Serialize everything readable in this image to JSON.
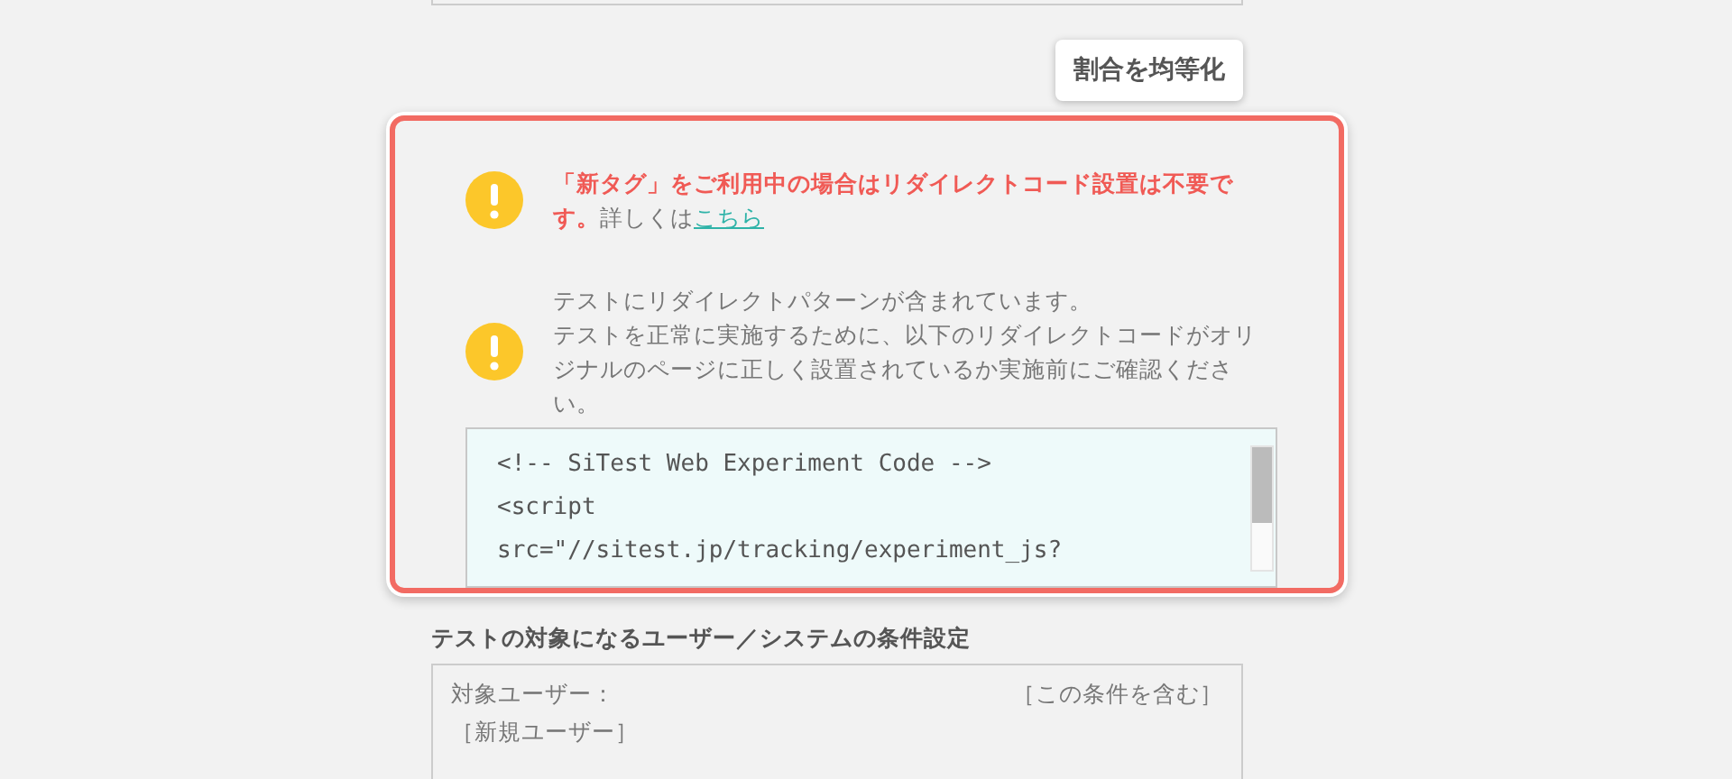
{
  "equalize_button": {
    "label": "割合を均等化"
  },
  "notice_dialog": {
    "warnings": [
      {
        "kind": "tag",
        "emphasis": "「新タグ」をご利用中の場合はリダイレクトコード設置は不要です。",
        "text": "詳しくは",
        "link": "こちら"
      },
      {
        "kind": "redirect",
        "lines": [
          "テストにリダイレクトパターンが含まれています。",
          "テストを正常に実施するために、以下のリダイレクトコードがオリジナルのページに正しく設置されているか実施前にご確認ください。"
        ]
      }
    ],
    "code_lines": [
      "<!-- SiTest Web Experiment Code -->",
      "<script",
      "src=\"//sitest.jp/tracking/experiment_js?"
    ]
  },
  "conditions": {
    "heading": "テストの対象になるユーザー／システムの条件設定",
    "label": "対象ユーザー：",
    "mode": "［この条件を含む］",
    "value": "［新規ユーザー］"
  }
}
